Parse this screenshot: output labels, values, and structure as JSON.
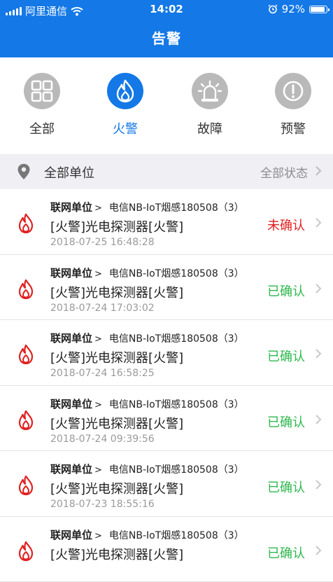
{
  "status_bar": {
    "carrier": "阿里通信",
    "time": "14:02",
    "battery": "92%",
    "battery_level": 0.92
  },
  "header": {
    "title": "告警"
  },
  "tabs": [
    {
      "label": "全部",
      "icon": "grid-icon",
      "active": false
    },
    {
      "label": "火警",
      "icon": "fire-icon",
      "active": true
    },
    {
      "label": "故障",
      "icon": "alarm-light-icon",
      "active": false
    },
    {
      "label": "预警",
      "icon": "exclamation-icon",
      "active": false
    }
  ],
  "filter": {
    "unit_label": "全部单位",
    "status_label": "全部状态"
  },
  "colors": {
    "primary": "#1478e6",
    "unconfirmed": "#e02020",
    "confirmed": "#2db84d",
    "fire_icon": "#e02020"
  },
  "alarms": [
    {
      "unit": "联网单位",
      "arrow": ">",
      "device": "电信NB-IoT烟感180508（3）",
      "title": "[火警]光电探测器[火警]",
      "time": "2018-07-25 16:48:28",
      "status": "未确认"
    },
    {
      "unit": "联网单位",
      "arrow": ">",
      "device": "电信NB-IoT烟感180508（3）",
      "title": "[火警]光电探测器[火警]",
      "time": "2018-07-24 17:03:02",
      "status": "已确认"
    },
    {
      "unit": "联网单位",
      "arrow": ">",
      "device": "电信NB-IoT烟感180508（3）",
      "title": "[火警]光电探测器[火警]",
      "time": "2018-07-24 16:58:25",
      "status": "已确认"
    },
    {
      "unit": "联网单位",
      "arrow": ">",
      "device": "电信NB-IoT烟感180508（3）",
      "title": "[火警]光电探测器[火警]",
      "time": "2018-07-24 09:39:56",
      "status": "已确认"
    },
    {
      "unit": "联网单位",
      "arrow": ">",
      "device": "电信NB-IoT烟感180508（3）",
      "title": "[火警]光电探测器[火警]",
      "time": "2018-07-23 18:55:16",
      "status": "已确认"
    },
    {
      "unit": "联网单位",
      "arrow": ">",
      "device": "电信NB-IoT烟感180508（3）",
      "title": "[火警]光电探测器[火警]",
      "time": "",
      "status": "已确认"
    }
  ]
}
